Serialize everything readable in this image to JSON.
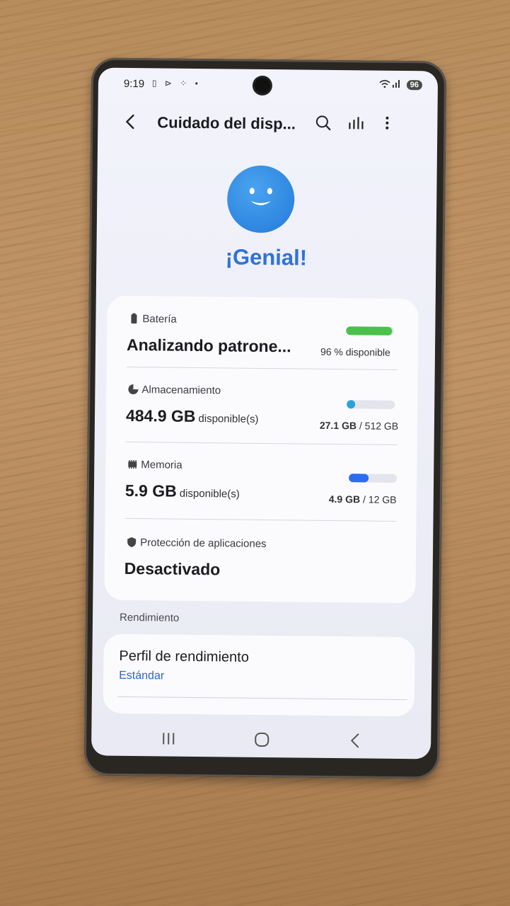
{
  "status_bar": {
    "time": "9:19",
    "battery": "96"
  },
  "app_bar": {
    "title": "Cuidado del disp..."
  },
  "hero": {
    "status_text": "¡Genial!"
  },
  "battery": {
    "label": "Batería",
    "value": "Analizando patrone...",
    "meta": "96 % disponible",
    "level": 0.96,
    "color": "#4cc04a"
  },
  "storage": {
    "label": "Almacenamiento",
    "value": "484.9 GB",
    "suffix": "disponible(s)",
    "used": "27.1 GB",
    "total": "/ 512 GB",
    "used_fraction": 0.053,
    "color": "#2aa3d8"
  },
  "memory": {
    "label": "Memoria",
    "value": "5.9 GB",
    "suffix": "disponible(s)",
    "used": "4.9 GB",
    "total": "/ 12 GB",
    "used_fraction": 0.41,
    "color": "#2c6cf0"
  },
  "app_protection": {
    "label": "Protección de aplicaciones",
    "value": "Desactivado"
  },
  "performance": {
    "section_label": "Rendimiento",
    "title": "Perfil de rendimiento",
    "value": "Estándar"
  },
  "icons": {
    "back": "back-arrow-icon",
    "search": "search-icon",
    "stats": "stats-icon",
    "more": "more-vert-icon",
    "battery": "battery-icon",
    "storage": "storage-pie-icon",
    "memory": "memory-chip-icon",
    "shield": "shield-icon"
  }
}
